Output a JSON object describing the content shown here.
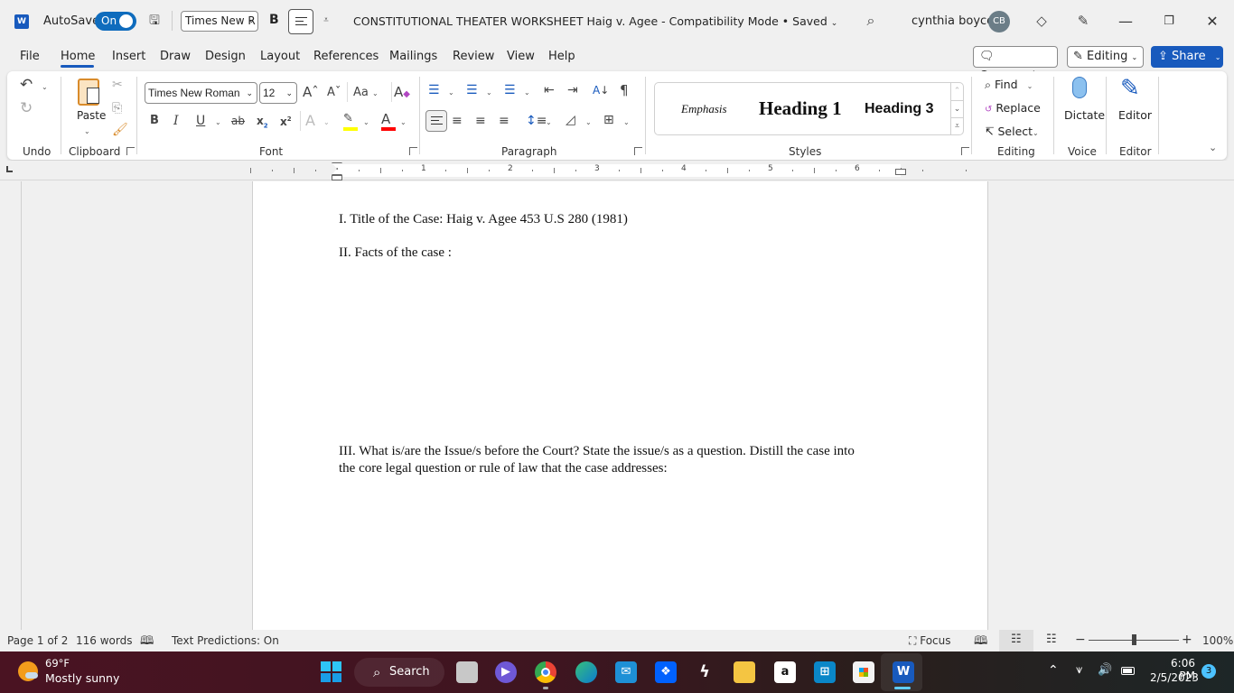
{
  "titlebar": {
    "autosave_label": "AutoSave",
    "autosave_state": "On",
    "qat_font": "Times New R",
    "qat_bold": "B",
    "doc_title": "CONSTITUTIONAL THEATER WORKSHEET Haig v. Agee  -  Compatibility Mode • Saved",
    "user_name": "cynthia boyce",
    "user_initials": "CB"
  },
  "tabs": [
    "File",
    "Home",
    "Insert",
    "Draw",
    "Design",
    "Layout",
    "References",
    "Mailings",
    "Review",
    "View",
    "Help"
  ],
  "active_tab": "Home",
  "tab_actions": {
    "comments": "Comments",
    "editing": "Editing",
    "share": "Share"
  },
  "ribbon": {
    "groups": {
      "undo": "Undo",
      "clipboard": "Clipboard",
      "font": "Font",
      "paragraph": "Paragraph",
      "styles": "Styles",
      "editing": "Editing",
      "voice": "Voice",
      "editor": "Editor"
    },
    "paste_label": "Paste",
    "font_name": "Times New Roman",
    "font_size": "12",
    "change_case": "Aa",
    "styles": [
      "Emphasis",
      "Heading 1",
      "Heading 3"
    ],
    "find": "Find",
    "replace": "Replace",
    "select": "Select",
    "dictate": "Dictate",
    "editor": "Editor",
    "highlight_color": "#ffff00",
    "font_color": "#ff0000"
  },
  "ruler": {
    "numbers": [
      "1",
      "2",
      "3",
      "4",
      "5",
      "6"
    ]
  },
  "document": {
    "paragraphs": [
      "I. Title of the Case:  Haig v. Agee 453 U.S 280 (1981)",
      "II. Facts of the case :",
      "III. What is/are the Issue/s before the Court? State the issue/s as a question. Distill the case into",
      "the core legal question or rule of law that the case addresses:"
    ]
  },
  "statusbar": {
    "page": "Page 1 of 2",
    "words": "116 words",
    "text_predictions": "Text Predictions: On",
    "focus": "Focus",
    "zoom_level": "100%",
    "zoom_percent": 100
  },
  "taskbar": {
    "weather_temp": "69°F",
    "weather_desc": "Mostly sunny",
    "search_label": "Search",
    "time": "6:06 PM",
    "date": "2/5/2023",
    "notification_count": "3"
  }
}
